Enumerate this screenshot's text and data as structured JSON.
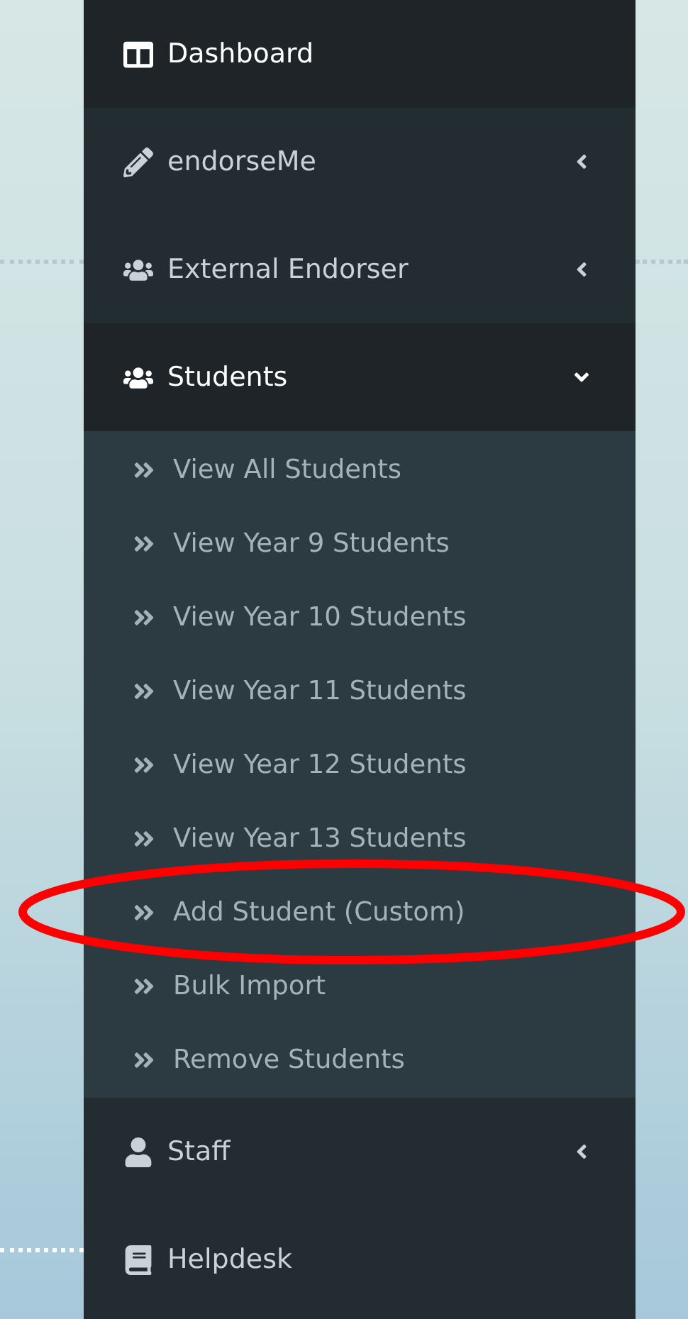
{
  "menu": [
    {
      "label": "Dashboard",
      "active": true
    },
    {
      "label": "endorseMe",
      "active": false,
      "expanded": false
    },
    {
      "label": "External Endorser",
      "active": false,
      "expanded": false
    },
    {
      "label": "Students",
      "active": true,
      "expanded": true,
      "children": [
        {
          "label": "View All Students",
          "circled": false
        },
        {
          "label": "View Year 9 Students",
          "circled": false
        },
        {
          "label": "View Year 10 Students",
          "circled": false
        },
        {
          "label": "View Year 11 Students",
          "circled": false
        },
        {
          "label": "View Year 12 Students",
          "circled": false
        },
        {
          "label": "View Year 13 Students",
          "circled": false
        },
        {
          "label": "Add Student (Custom)",
          "circled": true
        },
        {
          "label": "Bulk Import",
          "circled": false
        },
        {
          "label": "Remove Students",
          "circled": false
        }
      ]
    },
    {
      "label": "Staff",
      "active": false,
      "expanded": false
    },
    {
      "label": "Helpdesk",
      "active": false
    }
  ]
}
